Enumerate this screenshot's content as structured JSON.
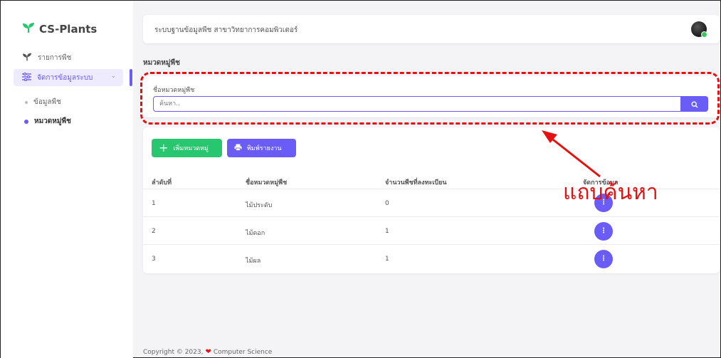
{
  "brand": {
    "name": "CS-Plants",
    "icon": "seedling-icon"
  },
  "sidebar": {
    "items": [
      {
        "label": "รายการพืช",
        "icon": "seedling-icon"
      },
      {
        "label": "จัดการข้อมูลระบบ",
        "icon": "sliders-icon"
      }
    ],
    "sub_items": [
      {
        "label": "ข้อมูลพืช"
      },
      {
        "label": "หมวดหมู่พืช"
      }
    ]
  },
  "header": {
    "title": "ระบบฐานข้อมูลพืช สาขาวิทยาการคอมพิวเตอร์"
  },
  "page": {
    "title": "หมวดหมู่พืช"
  },
  "search": {
    "label": "ชื่อหมวดหมู่พืช",
    "placeholder": "ค้นหา.."
  },
  "toolbar": {
    "add_label": "เพิ่มหมวดหมู่",
    "print_label": "พิมพ์รายงาน"
  },
  "table": {
    "headers": [
      "ลำดับที่",
      "ชื่อหมวดหมู่พืช",
      "จำนวนพืชที่ลงทะเบียน",
      "จัดการข้อมูล"
    ],
    "rows": [
      {
        "no": "1",
        "name": "ไม้ประดับ",
        "count": "0"
      },
      {
        "no": "2",
        "name": "ไม้ดอก",
        "count": "1"
      },
      {
        "no": "3",
        "name": "ไม้ผล",
        "count": "1"
      }
    ]
  },
  "annotation": {
    "text": "แถบค้นหา"
  },
  "footer": {
    "prefix": "Copyright © 2023,",
    "suffix": "Computer Science"
  },
  "colors": {
    "accent": "#6a5cf6",
    "success": "#28c66f",
    "annotation": "#e51010"
  }
}
